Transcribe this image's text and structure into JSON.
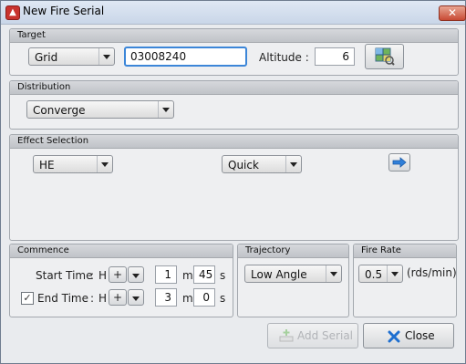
{
  "window": {
    "title": "New Fire Serial",
    "close_glyph": "✕"
  },
  "target": {
    "header": "Target",
    "grid_type": "Grid",
    "grid_value": "03008240",
    "altitude_label": "Altitude :",
    "altitude_value": "6",
    "map_icon": "map-picker-icon"
  },
  "distribution": {
    "header": "Distribution",
    "value": "Converge"
  },
  "effect": {
    "header": "Effect Selection",
    "ammo": "HE",
    "fuze": "Quick",
    "arrow_icon": "arrow-right-icon"
  },
  "commence": {
    "header": "Commence",
    "start": {
      "label": "Start Time",
      "colon": ":",
      "h": "H",
      "sign": "+",
      "minutes": "1",
      "m_unit": "m",
      "seconds": "45",
      "s_unit": "s"
    },
    "end": {
      "label": "End Time",
      "colon": ":",
      "h": "H",
      "sign": "+",
      "minutes": "3",
      "m_unit": "m",
      "seconds": "0",
      "s_unit": "s",
      "checked": true,
      "check_glyph": "✓"
    }
  },
  "trajectory": {
    "header": "Trajectory",
    "value": "Low Angle"
  },
  "fire_rate": {
    "header": "Fire Rate",
    "value": "0.5",
    "unit": "(rds/min)"
  },
  "buttons": {
    "add_serial": "Add Serial",
    "close": "Close"
  },
  "colors": {
    "close_icon": "#1e6fd0",
    "add_icon": "#7bbf6a"
  }
}
